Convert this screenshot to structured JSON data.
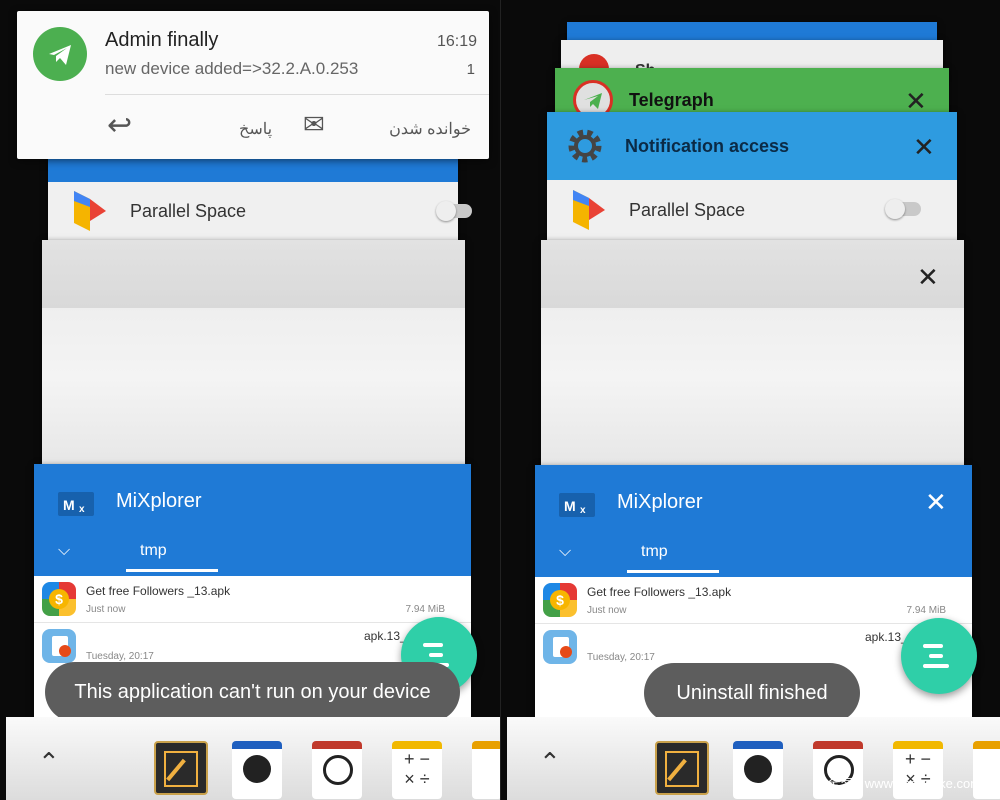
{
  "notification": {
    "title": "Admin finally",
    "time": "16:19",
    "message": "new device added=>32.2.A.0.253",
    "count": "1",
    "reply_label": "پاسخ",
    "mark_read_label": "خوانده شدن"
  },
  "left": {
    "parallel_space_label": "Parallel Space",
    "mixplorer_title": "MiXplorer",
    "tab_label": "tmp",
    "file1_name": "Get free Followers _13.apk",
    "file1_time": "Just now",
    "file1_size": "7.94 MiB",
    "file2_name": "apk.13_",
    "file2_time": "Tuesday, 20:17",
    "toast": "This application can't run on your device"
  },
  "right": {
    "telegraph_title": "Telegraph",
    "notification_access_title": "Notification access",
    "parallel_space_label": "Parallel Space",
    "mixplorer_title": "MiXplorer",
    "tab_label": "tmp",
    "file1_name": "Get free Followers _13.apk",
    "file1_time": "Just now",
    "file1_size": "7.94 MiB",
    "file2_name": "apk.13_",
    "file2_time": "Tuesday, 20:17",
    "toast": "Uninstall finished",
    "partial_card_title": "Sh"
  },
  "watermark": "安全客 ( www.anquanke.com )",
  "colors": {
    "mixplorer_blue": "#1f7ad6",
    "notification_access_blue": "#2e9be0",
    "telegraph_green": "#4db04f",
    "fab_teal": "#2fcfa8",
    "toast_gray": "#5d5d5d"
  },
  "dock_icons": [
    "notepad-icon",
    "globe-icon",
    "clock-icon",
    "calculator-icon",
    "crop-icon"
  ]
}
